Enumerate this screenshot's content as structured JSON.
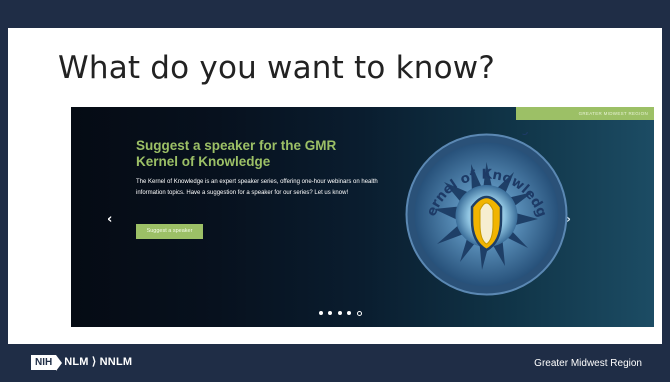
{
  "slide": {
    "title": "What do you want to know?"
  },
  "carousel": {
    "region_tag": "GREATER MIDWEST REGION",
    "heading_line1": "Suggest a speaker for the GMR",
    "heading_line2": "Kernel of Knowledge",
    "body": "The Kernel of Knowledge is an expert speaker series, offering one-hour webinars on health information topics. Have a suggestion for a speaker for our series? Let us know!",
    "cta_label": "Suggest a speaker",
    "badge_text": "Kernel of Knowledge",
    "prev_icon": "‹",
    "next_icon": "›",
    "indicator_count": 5,
    "active_indicator": 5
  },
  "footer": {
    "nih_label": "NIH",
    "logo_text": "NLM ⟩ NNLM",
    "region": "Greater Midwest Region"
  },
  "colors": {
    "frame": "#1f2d46",
    "accent_green": "#9cc066",
    "gold": "#f1b400"
  }
}
